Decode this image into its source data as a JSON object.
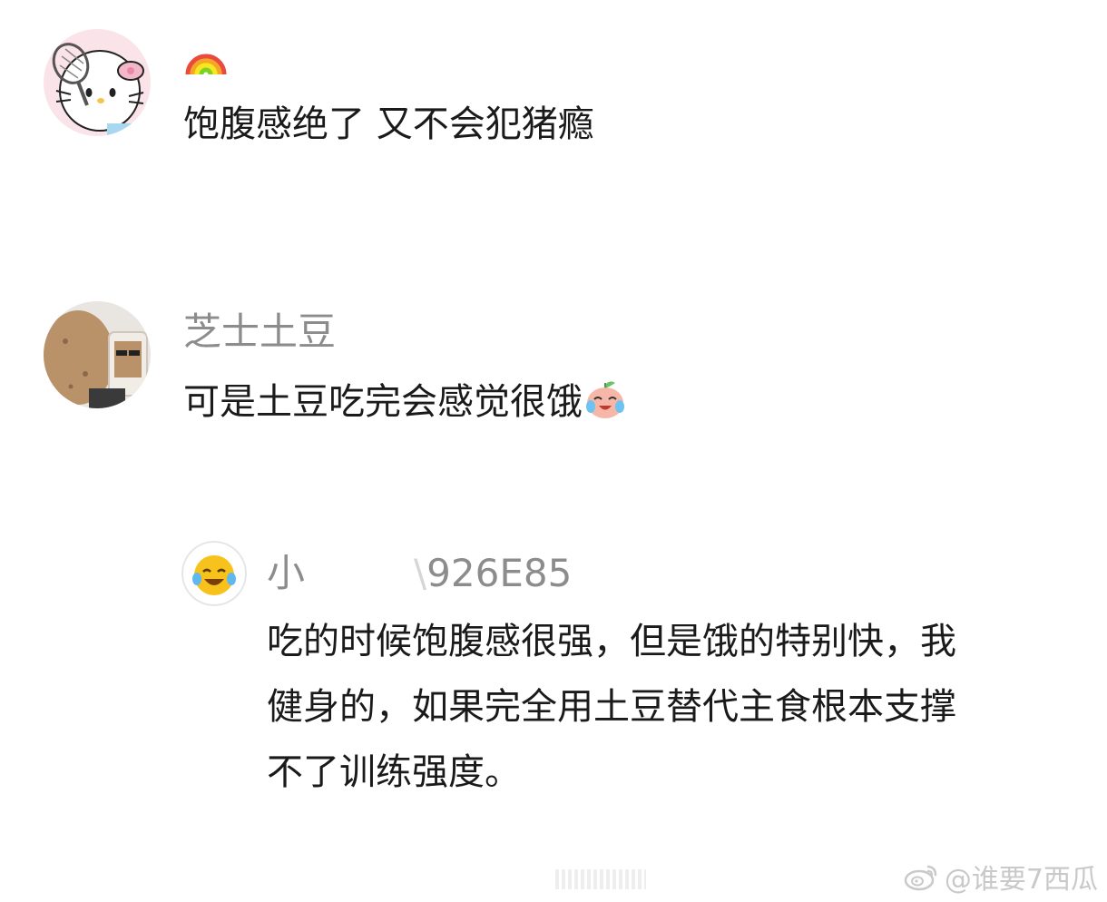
{
  "comments": [
    {
      "username": "",
      "username_emoji": "rainbow-icon",
      "text": "饱腹感绝了 又不会犯猪瘾",
      "avatar": "hello-kitty-avatar"
    },
    {
      "username": "芝士土豆",
      "text": "可是土豆吃完会感觉很饿",
      "text_emoji": "crying-laughing-peach-icon",
      "avatar": "potato-avatar"
    }
  ],
  "reply": {
    "username": "小",
    "username_tail": "926E85",
    "avatar": "laughing-emoji-avatar",
    "lines": [
      "吃的时候饱腹感很强，但是饿的特别快，我",
      "健身的，如果完全用土豆替代主食根本支撑",
      "不了训练强度。"
    ]
  },
  "watermark": {
    "text": "@谁要7西瓜",
    "icon": "weibo-logo-icon"
  }
}
